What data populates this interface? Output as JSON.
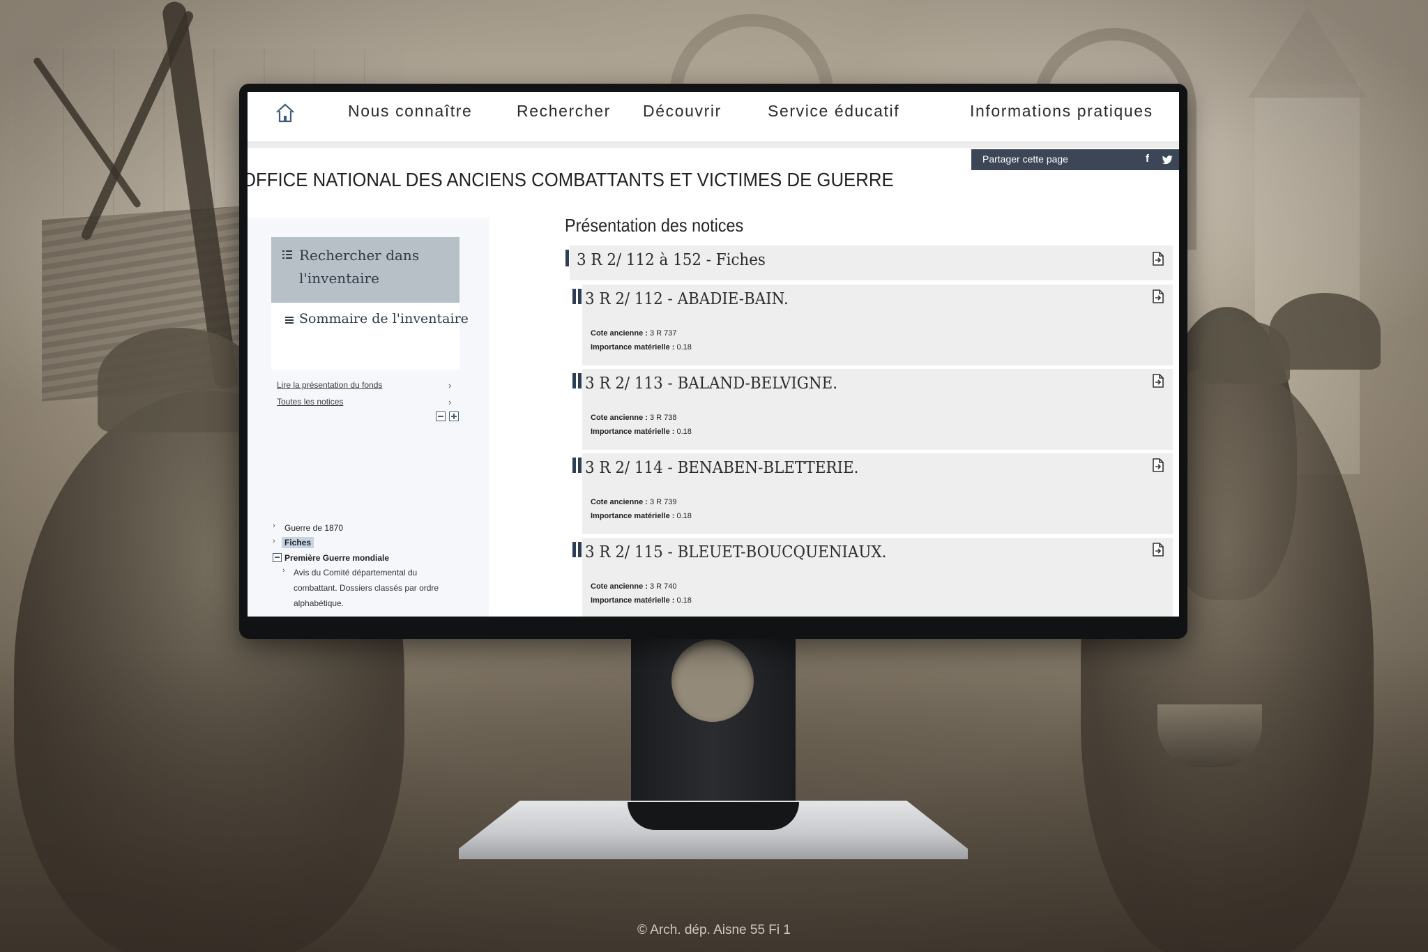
{
  "nav": {
    "items": [
      "Nous connaître",
      "Rechercher",
      "Découvrir",
      "Service éducatif",
      "Informations pratiques"
    ]
  },
  "share": {
    "label": "Partager cette page",
    "facebook": "f"
  },
  "page_title": "OFFICE NATIONAL DES ANCIENS COMBATTANTS ET VICTIMES DE GUERRE",
  "sidebar": {
    "search_label": "Rechercher dans l'inventaire",
    "summary_label": "Sommaire de l'inventaire",
    "links": [
      "Lire la présentation du fonds",
      "Toutes les notices"
    ],
    "tree": [
      {
        "label": "Guerre de 1870"
      },
      {
        "label": "Fiches"
      },
      {
        "label": "Première Guerre mondiale"
      },
      {
        "label": "Avis du Comité départemental du combattant. Dossiers classés par ordre alphabétique."
      }
    ]
  },
  "main": {
    "heading": "Présentation des notices",
    "notices": [
      {
        "title": "3 R 2/ 112 à 152 - Fiches"
      },
      {
        "title": "3 R 2/ 112 - ABADIE-BAIN.",
        "cote_label": "Cote ancienne :",
        "cote": "3 R 737",
        "importance_label": "Importance matérielle :",
        "importance": "0.18"
      },
      {
        "title": "3 R 2/ 113 - BALAND-BELVIGNE.",
        "cote_label": "Cote ancienne :",
        "cote": "3 R 738",
        "importance_label": "Importance matérielle :",
        "importance": "0.18"
      },
      {
        "title": "3 R 2/ 114 - BENABEN-BLETTERIE.",
        "cote_label": "Cote ancienne :",
        "cote": "3 R 739",
        "importance_label": "Importance matérielle :",
        "importance": "0.18"
      },
      {
        "title": "3 R 2/ 115 - BLEUET-BOUCQUENIAUX.",
        "cote_label": "Cote ancienne :",
        "cote": "3 R 740",
        "importance_label": "Importance matérielle :",
        "importance": "0.18"
      }
    ]
  },
  "credit": "© Arch. dép. Aisne  55 Fi 1",
  "colors": {
    "accent": "#2e3f55",
    "share_bg": "#3d4656",
    "search_bg": "#b8c0c7"
  }
}
